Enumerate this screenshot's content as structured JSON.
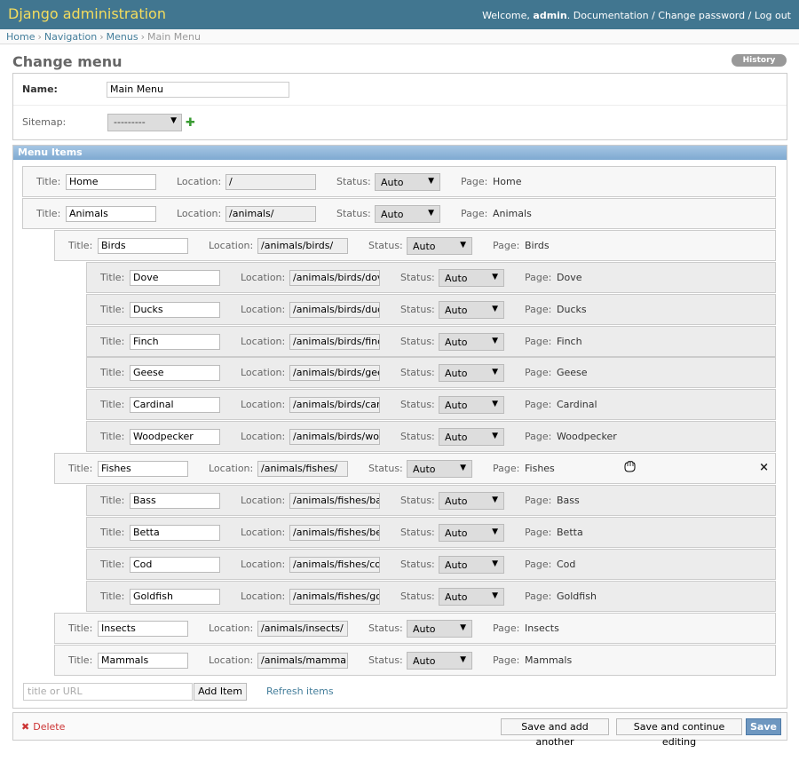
{
  "header": {
    "branding": "Django administration",
    "welcome": "Welcome,",
    "user": "admin",
    "links": [
      "Documentation",
      "Change password",
      "Log out"
    ],
    "separator": " / "
  },
  "breadcrumbs": [
    "Home",
    "Navigation",
    "Menus",
    "Main Menu"
  ],
  "page": {
    "title": "Change menu",
    "history_label": "History"
  },
  "form": {
    "name_label": "Name:",
    "name_value": "Main Menu",
    "sitemap_label": "Sitemap:",
    "sitemap_value": "---------"
  },
  "menu_items": {
    "heading": "Menu Items",
    "labels": {
      "title": "Title:",
      "location": "Location:",
      "status": "Status:",
      "page": "Page:"
    },
    "items": [
      {
        "title": "Home",
        "location": "/",
        "status": "Auto",
        "page": "Home",
        "depth": 0
      },
      {
        "title": "Animals",
        "location": "/animals/",
        "status": "Auto",
        "page": "Animals",
        "depth": 0
      },
      {
        "title": "Birds",
        "location": "/animals/birds/",
        "status": "Auto",
        "page": "Birds",
        "depth": 1
      },
      {
        "title": "Dove",
        "location": "/animals/birds/dov",
        "status": "Auto",
        "page": "Dove",
        "depth": 2
      },
      {
        "title": "Ducks",
        "location": "/animals/birds/duc",
        "status": "Auto",
        "page": "Ducks",
        "depth": 2
      },
      {
        "title": "Finch",
        "location": "/animals/birds/finc",
        "status": "Auto",
        "page": "Finch",
        "depth": 2
      },
      {
        "title": "Geese",
        "location": "/animals/birds/gee",
        "status": "Auto",
        "page": "Geese",
        "depth": 2
      },
      {
        "title": "Cardinal",
        "location": "/animals/birds/car",
        "status": "Auto",
        "page": "Cardinal",
        "depth": 2
      },
      {
        "title": "Woodpecker",
        "location": "/animals/birds/woo",
        "status": "Auto",
        "page": "Woodpecker",
        "depth": 2
      },
      {
        "title": "Fishes",
        "location": "/animals/fishes/",
        "status": "Auto",
        "page": "Fishes",
        "depth": 1,
        "hovered": true
      },
      {
        "title": "Bass",
        "location": "/animals/fishes/ba",
        "status": "Auto",
        "page": "Bass",
        "depth": 2
      },
      {
        "title": "Betta",
        "location": "/animals/fishes/be",
        "status": "Auto",
        "page": "Betta",
        "depth": 2
      },
      {
        "title": "Cod",
        "location": "/animals/fishes/co",
        "status": "Auto",
        "page": "Cod",
        "depth": 2
      },
      {
        "title": "Goldfish",
        "location": "/animals/fishes/go",
        "status": "Auto",
        "page": "Goldfish",
        "depth": 2
      },
      {
        "title": "Insects",
        "location": "/animals/insects/",
        "status": "Auto",
        "page": "Insects",
        "depth": 1
      },
      {
        "title": "Mammals",
        "location": "/animals/mammal:",
        "status": "Auto",
        "page": "Mammals",
        "depth": 1
      }
    ],
    "add_placeholder": "title or URL",
    "add_button": "Add Item",
    "refresh_link": "Refresh items",
    "delete_icon": "×"
  },
  "submit_row": {
    "delete_label": "Delete",
    "save_add_another": "Save and add another",
    "save_continue": "Save and continue editing",
    "save": "Save"
  }
}
